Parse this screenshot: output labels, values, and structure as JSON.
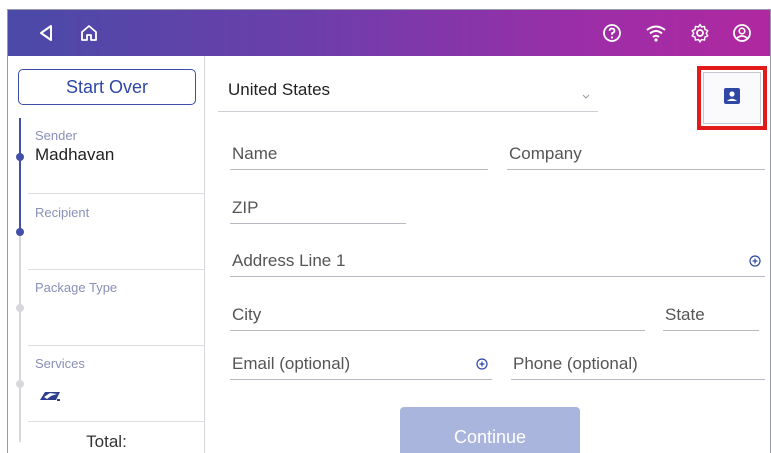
{
  "topbar": {
    "back_icon": "back-triangle-icon",
    "home_icon": "home-icon",
    "help_icon": "help-icon",
    "wifi_icon": "wifi-icon",
    "settings_icon": "gear-icon",
    "account_icon": "account-icon",
    "gradient_start": "#4a4aa8",
    "gradient_end": "#b0289f"
  },
  "sidebar": {
    "start_over_label": "Start Over",
    "steps": [
      {
        "label": "Sender",
        "value": "Madhavan"
      },
      {
        "label": "Recipient",
        "value": ""
      },
      {
        "label": "Package Type",
        "value": ""
      },
      {
        "label": "Services",
        "value": ""
      }
    ],
    "total_label": "Total:"
  },
  "form": {
    "country": "United States",
    "fields": {
      "name": "Name",
      "company": "Company",
      "zip": "ZIP",
      "address1": "Address Line 1",
      "city": "City",
      "state": "State",
      "email": "Email (optional)",
      "phone": "Phone (optional)"
    },
    "continue_label": "Continue"
  },
  "colors": {
    "accent": "#2f47a5",
    "highlight": "#e21a1a",
    "continue_bg": "#a9b5dd"
  }
}
